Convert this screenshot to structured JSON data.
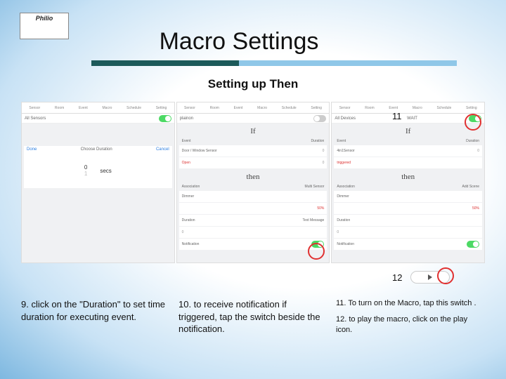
{
  "logo": "Philio",
  "title": "Macro Settings",
  "subtitle": "Setting up Then",
  "tabbar": [
    "Sensor",
    "Room",
    "Event",
    "Macro",
    "Schedule",
    "Setting"
  ],
  "shot1": {
    "filter_label": "All Sensors",
    "picker": {
      "done": "Done",
      "title": "Choose Duration",
      "cancel": "Cancel",
      "val": "0",
      "unit": "secs",
      "alt": "1"
    }
  },
  "shot2": {
    "if": "If",
    "then": "then",
    "event_label": "Event",
    "duration_label": "Duration",
    "event_value": "Door / Window Sensor",
    "open": "Open",
    "dur_row1": "0",
    "dur_row2": "0",
    "association": "Association",
    "multisensor": "Multi Sensor",
    "dimmer": "Dimmer",
    "level": "50%",
    "duration": "Duration",
    "dur_val": "0",
    "text_msg": "Text Message",
    "notification": "Notification"
  },
  "shot3": {
    "filter_label": "All Devices",
    "wait_label": "WAIT",
    "if": "If",
    "then": "then",
    "event_label": "Event",
    "duration_label": "Duration",
    "event_value": "4in1Sensor",
    "triggered": "triggered",
    "dur_row": "0",
    "assoc": "Association",
    "add_scene": "Add Scene",
    "dimmer": "Dimmer",
    "level": "50%",
    "duration": "Duration",
    "dur_val": "0",
    "notification": "Notification"
  },
  "callout_11": "11",
  "callout_12": "12",
  "instr9": "9. click on the \"Duration\" to set time duration for executing event.",
  "instr10": "10. to receive notification if triggered, tap the switch beside the notification.",
  "instr11": "11. To turn on the Macro, tap this switch .",
  "instr12": "12. to play the macro, click on the play icon."
}
